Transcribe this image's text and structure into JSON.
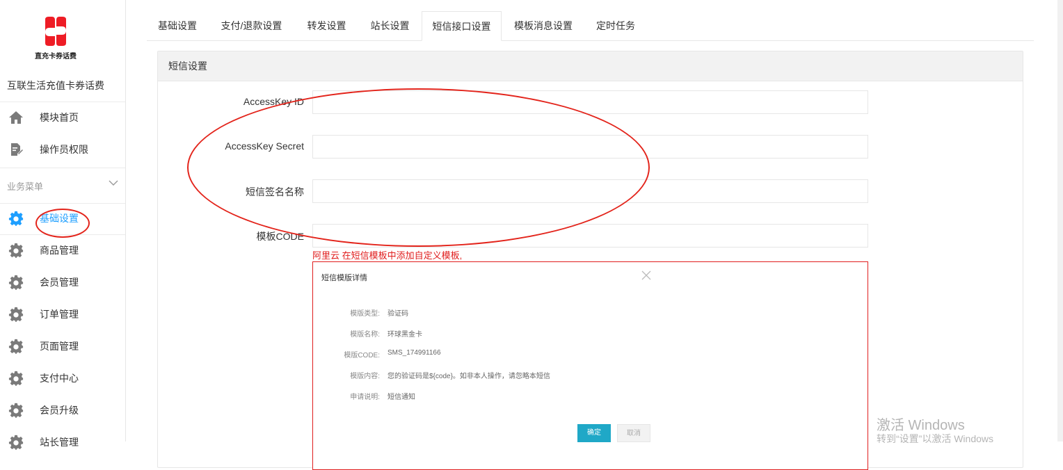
{
  "brand": {
    "logo_caption": "直充卡券话费",
    "app_name": "互联生活充值卡券话费",
    "color": "#ee1c25"
  },
  "sidebar": {
    "top_items": [
      {
        "label": "模块首页",
        "icon": "home-icon"
      },
      {
        "label": "操作员权限",
        "icon": "document-edit-icon"
      }
    ],
    "group_label": "业务菜单",
    "group_items": [
      {
        "label": "基础设置",
        "icon": "gear-icon",
        "active": true
      },
      {
        "label": "商品管理",
        "icon": "gear-icon"
      },
      {
        "label": "会员管理",
        "icon": "gear-icon"
      },
      {
        "label": "订单管理",
        "icon": "gear-icon"
      },
      {
        "label": "页面管理",
        "icon": "gear-icon"
      },
      {
        "label": "支付中心",
        "icon": "gear-icon"
      },
      {
        "label": "会员升级",
        "icon": "gear-icon"
      },
      {
        "label": "站长管理",
        "icon": "gear-icon"
      }
    ],
    "active_color": "#1e9fff"
  },
  "tabs": [
    {
      "label": "基础设置"
    },
    {
      "label": "支付/退款设置"
    },
    {
      "label": "转发设置"
    },
    {
      "label": "站长设置"
    },
    {
      "label": "短信接口设置",
      "active": true
    },
    {
      "label": "模板消息设置"
    },
    {
      "label": "定时任务"
    }
  ],
  "panel": {
    "title": "短信设置",
    "fields": [
      {
        "label": "AccessKey ID",
        "value": "",
        "placeholder": ""
      },
      {
        "label": "AccessKey Secret",
        "value": "",
        "placeholder": ""
      },
      {
        "label": "短信签名名称",
        "value": "",
        "placeholder": ""
      },
      {
        "label": "模板CODE",
        "value": "",
        "placeholder": ""
      }
    ],
    "hint": "阿里云 在短信模板中添加自定义模板,"
  },
  "template_dialog": {
    "title": "短信模版详情",
    "rows": [
      {
        "key": "模版类型:",
        "value": "验证码"
      },
      {
        "key": "模版名称:",
        "value": "环球黑金卡"
      },
      {
        "key": "模版CODE:",
        "value": "SMS_174991166"
      },
      {
        "key": "模版内容:",
        "value": "您的验证码是${code}。如非本人操作，请忽略本短信"
      },
      {
        "key": "申请说明:",
        "value": "短信通知"
      }
    ],
    "confirm_label": "确定",
    "cancel_label": "取消",
    "confirm_color": "#1fa8c7"
  },
  "annotation_color": "#e3241b",
  "watermark": {
    "line1": "激活 Windows",
    "line2": "转到“设置”以激活 Windows"
  }
}
